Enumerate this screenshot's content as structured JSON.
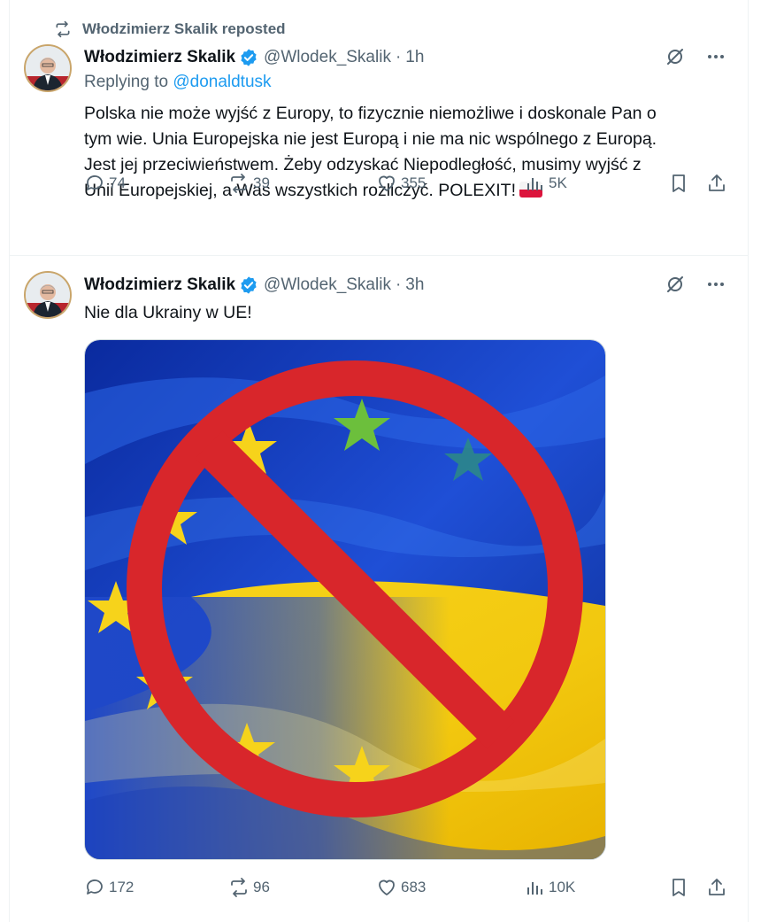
{
  "repost_banner": {
    "text": "Włodzimierz Skalik reposted"
  },
  "tweets": [
    {
      "author_name": "Włodzimierz Skalik",
      "handle": "@Wlodek_Skalik",
      "dot": "·",
      "time": "1h",
      "replying_prefix": "Replying to ",
      "replying_to": "@donaldtusk",
      "text": "Polska nie może wyjść z Europy, to fizycznie niemożliwe i doskonale Pan o\ntym wie. Unia Europejska nie jest Europą i nie ma nic wspólnego z Europą.\nJest jej przeciwieństwem. Żeby odzyskać Niepodległość, musimy wyjść z\nUnii Europejskiej, a Was wszystkich rozliczyć. POLEXIT!",
      "replies": "74",
      "reposts": "39",
      "likes": "355",
      "views": "5K"
    },
    {
      "author_name": "Włodzimierz Skalik",
      "handle": "@Wlodek_Skalik",
      "dot": "·",
      "time": "3h",
      "text": "Nie dla Ukrainy w UE!",
      "media_description": "EU flag and Ukrainian flag with a red prohibition sign",
      "replies": "172",
      "reposts": "96",
      "likes": "683",
      "views": "10K"
    }
  ],
  "icons": {
    "repost": "repost-icon",
    "verified": "verified-badge-icon",
    "grok": "grok-icon",
    "more": "more-icon",
    "reply": "reply-icon",
    "like": "heart-icon",
    "views": "views-icon",
    "bookmark": "bookmark-icon",
    "share": "share-icon"
  },
  "colors": {
    "accent": "#1d9bf0",
    "muted": "#536471",
    "text": "#0f1419",
    "eu_blue": "#1f3fbf",
    "ua_yellow": "#f5d020",
    "prohibition_red": "#d8262b"
  }
}
